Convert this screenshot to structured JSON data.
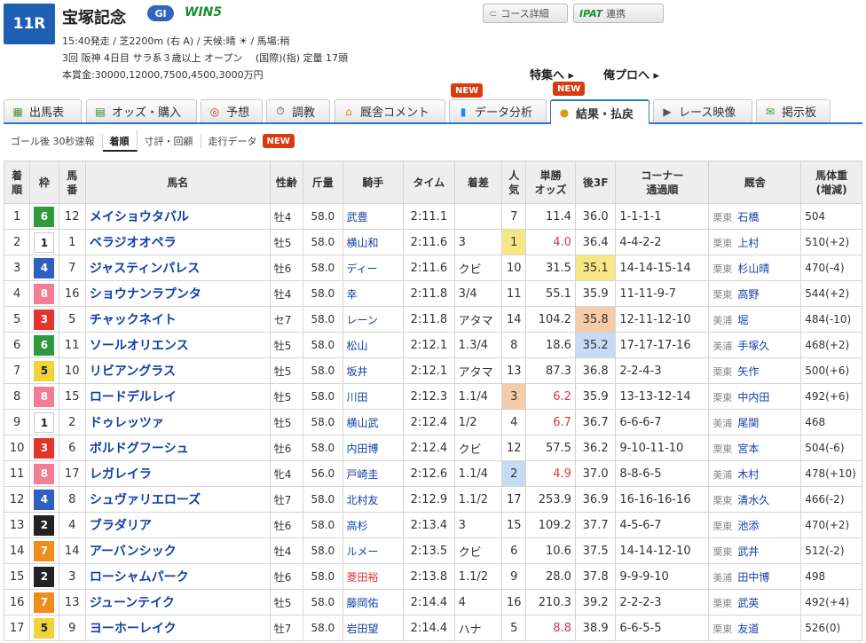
{
  "race": {
    "number": "11R",
    "name": "宝塚記念",
    "grade": "GI",
    "win5": "WIN5",
    "line1": "15:40発走 / 芝2200m (右 A) / 天候:晴 ☀ / 馬場:稍",
    "line2": "3回 阪神 4日目 サラ系３歳以上 オープン　 (国際)(指) 定量 17頭",
    "line3": "本賞金:30000,12000,7500,4500,3000万円"
  },
  "buttons": {
    "course": "コース詳細",
    "ipat": "IPAT",
    "ipat_suffix": "連携"
  },
  "links": {
    "feature": "特集へ ▸",
    "pro": "俺プロへ ▸"
  },
  "new_label": "NEW",
  "tabs": [
    {
      "label": "出馬表",
      "icon": "table-icon"
    },
    {
      "label": "オッズ・購入",
      "icon": "odds-icon"
    },
    {
      "label": "予想",
      "icon": "target-icon"
    },
    {
      "label": "調教",
      "icon": "stopwatch-icon"
    },
    {
      "label": "厩舎コメント",
      "icon": "stable-icon"
    },
    {
      "label": "データ分析",
      "icon": "bar-chart-icon"
    },
    {
      "label": "結果・払戻",
      "icon": "coins-icon"
    },
    {
      "label": "レース映像",
      "icon": "video-icon"
    },
    {
      "label": "掲示板",
      "icon": "chat-icon"
    }
  ],
  "subtabs": [
    "ゴール後 30秒速報",
    "着順",
    "寸評・回顧",
    "走行データ"
  ],
  "headers": [
    "着\n順",
    "枠",
    "馬\n番",
    "馬名",
    "性齢",
    "斤量",
    "騎手",
    "タイム",
    "着差",
    "人\n気",
    "単勝\nオッズ",
    "後3F",
    "コーナー\n通過順",
    "厩舎",
    "馬体重\n(増減)"
  ],
  "colors": {
    "waku": {
      "1": "#ffffff",
      "2": "#222222",
      "3": "#e3352d",
      "4": "#2f5fc0",
      "5": "#f3d33a",
      "6": "#2e9a3e",
      "7": "#f08c1e",
      "8": "#f47c95"
    },
    "fav1": "#f7e784",
    "fav2": "#c6dcf5",
    "fav3": "#f5cba8",
    "f3_1": "#f7e784",
    "f3_2": "#c6dcf5",
    "f3_3": "#f5cba8"
  },
  "rows": [
    {
      "pos": "1",
      "waku": "6",
      "num": "12",
      "name": "メイショウタバル",
      "sexage": "牡4",
      "kinryo": "58.0",
      "jockey": "武豊",
      "time": "2:11.1",
      "margin": "",
      "pop": "7",
      "odds": "11.4",
      "f3": "36.0",
      "corner": "1-1-1-1",
      "aff": "栗東",
      "trainer": "石橋",
      "weight": "504"
    },
    {
      "pos": "2",
      "waku": "1",
      "num": "1",
      "name": "ベラジオオペラ",
      "sexage": "牡5",
      "kinryo": "58.0",
      "jockey": "横山和",
      "time": "2:11.6",
      "margin": "3",
      "pop": "1",
      "odds": "4.0",
      "f3": "36.4",
      "corner": "4-4-2-2",
      "aff": "栗東",
      "trainer": "上村",
      "weight": "510(+2)"
    },
    {
      "pos": "3",
      "waku": "4",
      "num": "7",
      "name": "ジャスティンパレス",
      "sexage": "牡6",
      "kinryo": "58.0",
      "jockey": "ディー",
      "time": "2:11.6",
      "margin": "クビ",
      "pop": "10",
      "odds": "31.5",
      "f3": "35.1",
      "corner": "14-14-15-14",
      "aff": "栗東",
      "trainer": "杉山晴",
      "weight": "470(-4)"
    },
    {
      "pos": "4",
      "waku": "8",
      "num": "16",
      "name": "ショウナンラプンタ",
      "sexage": "牡4",
      "kinryo": "58.0",
      "jockey": "幸",
      "time": "2:11.8",
      "margin": "3/4",
      "pop": "11",
      "odds": "55.1",
      "f3": "35.9",
      "corner": "11-11-9-7",
      "aff": "栗東",
      "trainer": "高野",
      "weight": "544(+2)"
    },
    {
      "pos": "5",
      "waku": "3",
      "num": "5",
      "name": "チャックネイト",
      "sexage": "セ7",
      "kinryo": "58.0",
      "jockey": "レーン",
      "time": "2:11.8",
      "margin": "アタマ",
      "pop": "14",
      "odds": "104.2",
      "f3": "35.8",
      "corner": "12-11-12-10",
      "aff": "美浦",
      "trainer": "堀",
      "weight": "484(-10)"
    },
    {
      "pos": "6",
      "waku": "6",
      "num": "11",
      "name": "ソールオリエンス",
      "sexage": "牡5",
      "kinryo": "58.0",
      "jockey": "松山",
      "time": "2:12.1",
      "margin": "1.3/4",
      "pop": "8",
      "odds": "18.6",
      "f3": "35.2",
      "corner": "17-17-17-16",
      "aff": "美浦",
      "trainer": "手塚久",
      "weight": "468(+2)"
    },
    {
      "pos": "7",
      "waku": "5",
      "num": "10",
      "name": "リビアングラス",
      "sexage": "牡5",
      "kinryo": "58.0",
      "jockey": "坂井",
      "time": "2:12.1",
      "margin": "アタマ",
      "pop": "13",
      "odds": "87.3",
      "f3": "36.8",
      "corner": "2-2-4-3",
      "aff": "栗東",
      "trainer": "矢作",
      "weight": "500(+6)"
    },
    {
      "pos": "8",
      "waku": "8",
      "num": "15",
      "name": "ロードデルレイ",
      "sexage": "牡5",
      "kinryo": "58.0",
      "jockey": "川田",
      "time": "2:12.3",
      "margin": "1.1/4",
      "pop": "3",
      "odds": "6.2",
      "f3": "35.9",
      "corner": "13-13-12-14",
      "aff": "栗東",
      "trainer": "中内田",
      "weight": "492(+6)"
    },
    {
      "pos": "9",
      "waku": "1",
      "num": "2",
      "name": "ドゥレッツァ",
      "sexage": "牡5",
      "kinryo": "58.0",
      "jockey": "横山武",
      "time": "2:12.4",
      "margin": "1/2",
      "pop": "4",
      "odds": "6.7",
      "f3": "36.7",
      "corner": "6-6-6-7",
      "aff": "美浦",
      "trainer": "尾関",
      "weight": "468"
    },
    {
      "pos": "10",
      "waku": "3",
      "num": "6",
      "name": "ボルドグフーシュ",
      "sexage": "牡6",
      "kinryo": "58.0",
      "jockey": "内田博",
      "time": "2:12.4",
      "margin": "クビ",
      "pop": "12",
      "odds": "57.5",
      "f3": "36.2",
      "corner": "9-10-11-10",
      "aff": "栗東",
      "trainer": "宮本",
      "weight": "504(-6)"
    },
    {
      "pos": "11",
      "waku": "8",
      "num": "17",
      "name": "レガレイラ",
      "sexage": "牝4",
      "kinryo": "56.0",
      "jockey": "戸崎圭",
      "time": "2:12.6",
      "margin": "1.1/4",
      "pop": "2",
      "odds": "4.9",
      "f3": "37.0",
      "corner": "8-8-6-5",
      "aff": "美浦",
      "trainer": "木村",
      "weight": "478(+10)"
    },
    {
      "pos": "12",
      "waku": "4",
      "num": "8",
      "name": "シュヴァリエローズ",
      "sexage": "牡7",
      "kinryo": "58.0",
      "jockey": "北村友",
      "time": "2:12.9",
      "margin": "1.1/2",
      "pop": "17",
      "odds": "253.9",
      "f3": "36.9",
      "corner": "16-16-16-16",
      "aff": "栗東",
      "trainer": "清水久",
      "weight": "466(-2)"
    },
    {
      "pos": "13",
      "waku": "2",
      "num": "4",
      "name": "ブラダリア",
      "sexage": "牡6",
      "kinryo": "58.0",
      "jockey": "高杉",
      "time": "2:13.4",
      "margin": "3",
      "pop": "15",
      "odds": "109.2",
      "f3": "37.7",
      "corner": "4-5-6-7",
      "aff": "栗東",
      "trainer": "池添",
      "weight": "470(+2)"
    },
    {
      "pos": "14",
      "waku": "7",
      "num": "14",
      "name": "アーバンシック",
      "sexage": "牡4",
      "kinryo": "58.0",
      "jockey": "ルメー",
      "time": "2:13.5",
      "margin": "クビ",
      "pop": "6",
      "odds": "10.6",
      "f3": "37.5",
      "corner": "14-14-12-10",
      "aff": "栗東",
      "trainer": "武井",
      "weight": "512(-2)"
    },
    {
      "pos": "15",
      "waku": "2",
      "num": "3",
      "name": "ローシャムパーク",
      "sexage": "牡6",
      "kinryo": "58.0",
      "jockey": "菱田裕",
      "time": "2:13.8",
      "margin": "1.1/2",
      "pop": "9",
      "odds": "28.0",
      "f3": "37.8",
      "corner": "9-9-9-10",
      "aff": "美浦",
      "trainer": "田中博",
      "weight": "498",
      "jockey_red": true
    },
    {
      "pos": "16",
      "waku": "7",
      "num": "13",
      "name": "ジューンテイク",
      "sexage": "牡5",
      "kinryo": "58.0",
      "jockey": "藤岡佑",
      "time": "2:14.4",
      "margin": "4",
      "pop": "16",
      "odds": "210.3",
      "f3": "39.2",
      "corner": "2-2-2-3",
      "aff": "栗東",
      "trainer": "武英",
      "weight": "492(+4)"
    },
    {
      "pos": "17",
      "waku": "5",
      "num": "9",
      "name": "ヨーホーレイク",
      "sexage": "牡7",
      "kinryo": "58.0",
      "jockey": "岩田望",
      "time": "2:14.4",
      "margin": "ハナ",
      "pop": "5",
      "odds": "8.8",
      "f3": "38.9",
      "corner": "6-6-5-5",
      "aff": "栗東",
      "trainer": "友道",
      "weight": "526(0)"
    }
  ]
}
